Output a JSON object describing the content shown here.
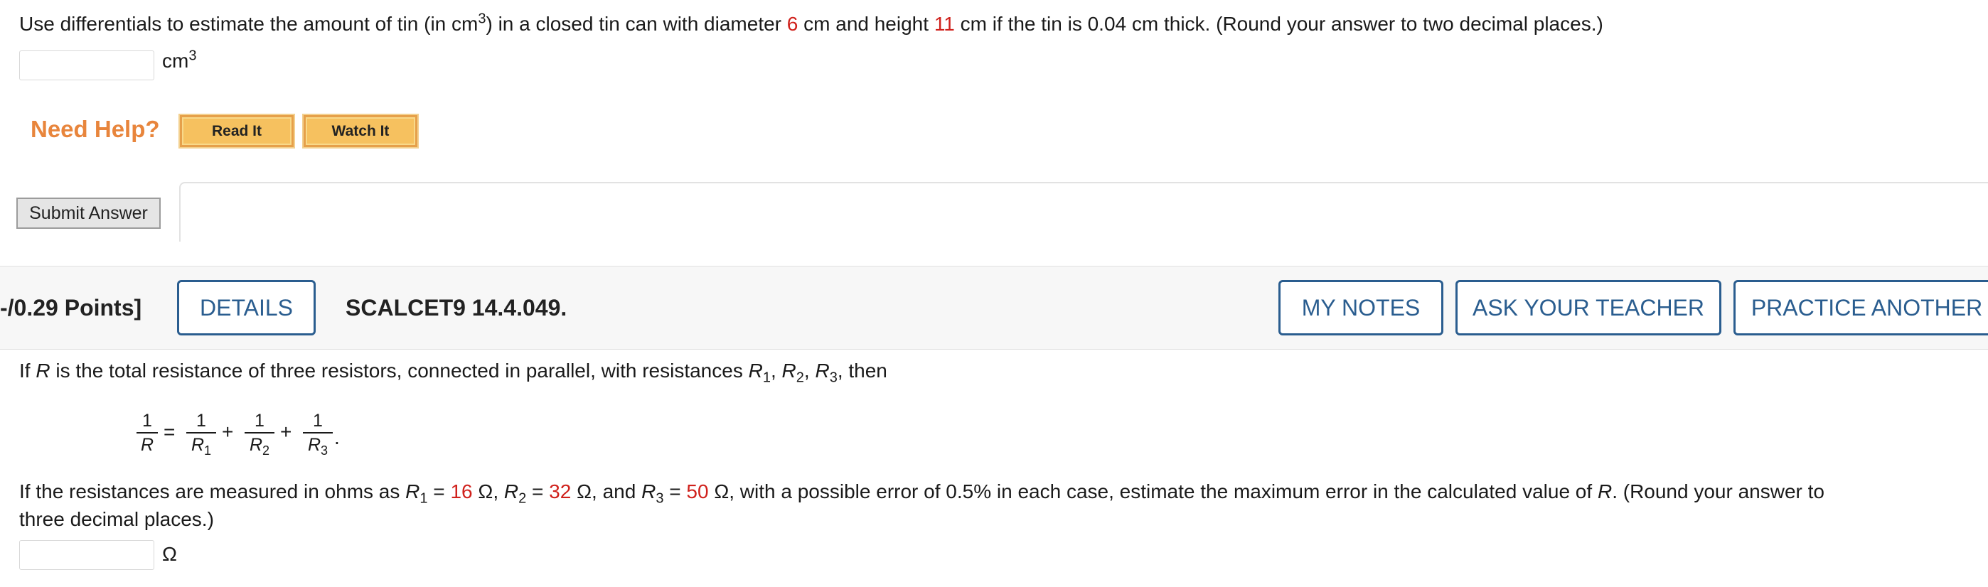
{
  "q1": {
    "text_a": "Use differentials to estimate the amount of tin (in cm",
    "text_a_sup": "3",
    "text_b": ") in a closed tin can with diameter ",
    "diameter": "6",
    "text_c": " cm and height ",
    "height": "11",
    "text_d": " cm if the tin is 0.04 cm thick. (Round your answer to two decimal places.)",
    "answer_value": "",
    "unit": "cm",
    "unit_sup": "3"
  },
  "help": {
    "label": "Need Help?",
    "read_it": "Read It",
    "watch_it": "Watch It"
  },
  "submit_label": "Submit Answer",
  "header": {
    "points": "-/0.29 Points]",
    "details": "DETAILS",
    "problem_id": "SCALCET9 14.4.049.",
    "my_notes": "MY NOTES",
    "ask_teacher": "ASK YOUR TEACHER",
    "practice": "PRACTICE ANOTHER"
  },
  "q2": {
    "intro_a": "If ",
    "R": "R",
    "intro_b": " is the total resistance of three resistors, connected in parallel, with resistances ",
    "intro_c": ", then",
    "r1": "R",
    "r1_sub": "1",
    "r2": "R",
    "r2_sub": "2",
    "r3": "R",
    "r3_sub": "3",
    "eq_one": "1",
    "eq_lhs_den": "R",
    "eq_equals": "=",
    "eq_plus": "+",
    "line2_a": "If the resistances are measured in ohms as ",
    "r1_val": "16",
    "ohm": "Ω",
    "r2_val": "32",
    "r3_val": "50",
    "line2_b": ", with a possible error of 0.5% in each case, estimate the maximum error in the calculated value of ",
    "line2_c": ". (Round your answer to",
    "line3": "three decimal places.)",
    "answer_value": "",
    "unit": "Ω"
  }
}
